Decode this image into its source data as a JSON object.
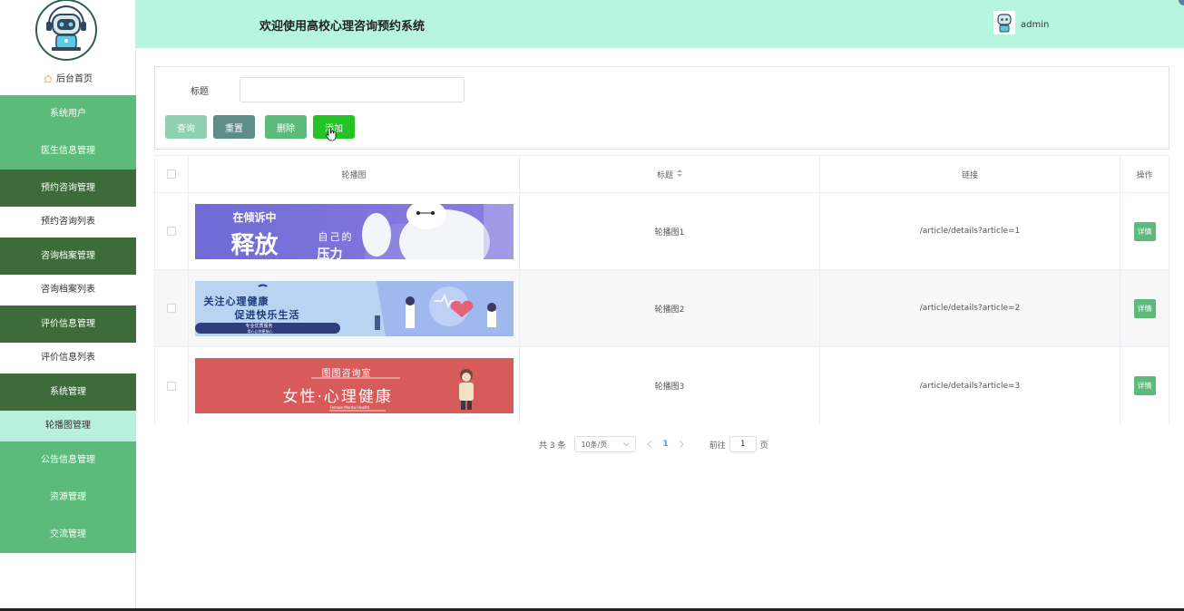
{
  "header": {
    "title": "欢迎使用高校心理咨询预约系统",
    "username": "admin"
  },
  "sidebar": {
    "home": "后台首页",
    "items": [
      {
        "label": "系统用户",
        "style": "light"
      },
      {
        "label": "医生信息管理",
        "style": "light"
      },
      {
        "label": "预约咨询管理",
        "style": "dark"
      },
      {
        "label": "预约咨询列表",
        "style": "sub"
      },
      {
        "label": "咨询档案管理",
        "style": "dark"
      },
      {
        "label": "咨询档案列表",
        "style": "sub"
      },
      {
        "label": "评价信息管理",
        "style": "dark"
      },
      {
        "label": "评价信息列表",
        "style": "sub"
      },
      {
        "label": "系统管理",
        "style": "dark"
      },
      {
        "label": "轮播图管理",
        "style": "active"
      },
      {
        "label": "公告信息管理",
        "style": "light"
      },
      {
        "label": "资源管理",
        "style": "light"
      },
      {
        "label": "交流管理",
        "style": "light"
      }
    ]
  },
  "search": {
    "label": "标题",
    "value": "",
    "placeholder": ""
  },
  "actions": {
    "query": "查询",
    "reset": "重置",
    "delete": "删除",
    "add": "添加"
  },
  "table": {
    "columns": {
      "image": "轮播图",
      "title": "标题",
      "link": "链接",
      "op": "操作"
    },
    "rows": [
      {
        "title": "轮播图1",
        "link": "/article/details?article=1",
        "action": "详情",
        "banner": {
          "text1": "在倾诉中",
          "text2": "释放",
          "text3": "自己的",
          "text4": "压力"
        }
      },
      {
        "title": "轮播图2",
        "link": "/article/details?article=2",
        "action": "详情",
        "banner": {
          "text1": "关注心理健康",
          "text2": "促进快乐生活",
          "text3": "专业优质服务",
          "text4": "用心让你更放心"
        }
      },
      {
        "title": "轮播图3",
        "link": "/article/details?article=3",
        "action": "详情",
        "banner": {
          "text1": "图图咨询室",
          "text2": "女性·心理健康",
          "text3": "Female Mental Health"
        }
      }
    ]
  },
  "pagination": {
    "total": "共 3 条",
    "page_size": "10条/页",
    "current": "1",
    "goto_prefix": "前往",
    "goto_value": "1",
    "goto_suffix": "页"
  },
  "colors": {
    "header_bg": "#b7f5e1",
    "menu_light": "#5cbb7a",
    "menu_dark": "#3d6b3a",
    "menu_active": "#b8f0dd",
    "add_button": "#22c322"
  },
  "icons": [
    "robot-avatar-icon",
    "home-icon",
    "user-avatar-icon",
    "sort-icon",
    "chevron-down-icon",
    "chevron-left-icon",
    "chevron-right-icon",
    "hand-cursor-icon"
  ]
}
